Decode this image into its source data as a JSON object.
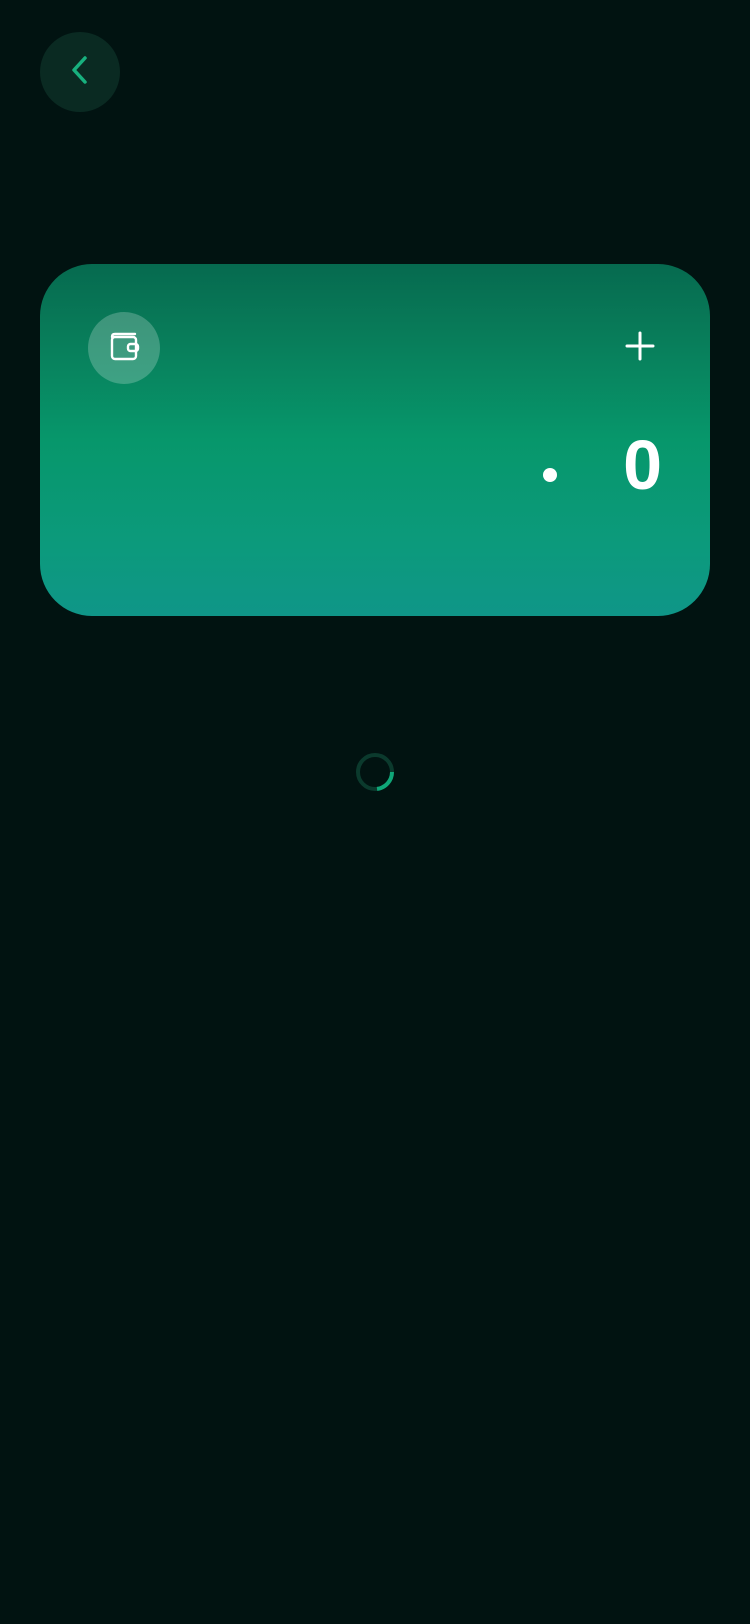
{
  "header": {
    "back_icon": "chevron-left-icon"
  },
  "wallet_card": {
    "wallet_icon": "wallet-icon",
    "add_icon": "plus-icon",
    "balance_value": "0",
    "gradient_colors": [
      "#066a4f",
      "#07976b",
      "#0f9688"
    ]
  },
  "loading": {
    "spinner_icon": "loading-spinner-icon",
    "accent_color": "#0fa678"
  },
  "colors": {
    "background": "#011311",
    "accent": "#18b07e"
  }
}
